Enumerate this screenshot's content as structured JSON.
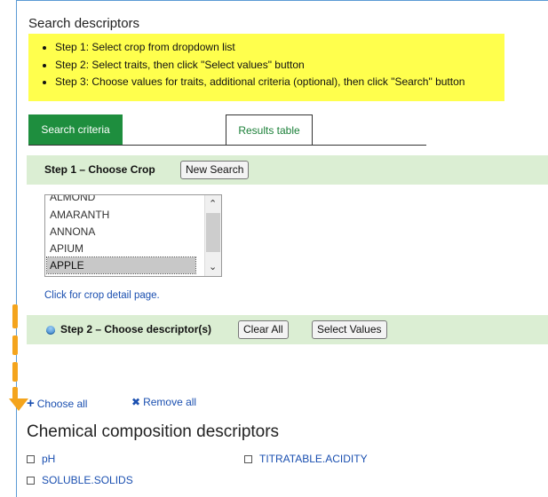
{
  "title": "Search descriptors",
  "instructions": [
    "Step 1: Select crop from dropdown list",
    "Step 2: Select traits, then click \"Select values\" button",
    "Step 3: Choose values for traits, additional criteria (optional), then click \"Search\" button"
  ],
  "tabs": {
    "search_criteria": "Search criteria",
    "results_table": "Results table"
  },
  "step1": {
    "label": "Step 1 – Choose Crop",
    "new_search": "New Search"
  },
  "crop_list": {
    "options": [
      "ALMOND",
      "AMARANTH",
      "ANNONA",
      "APIUM",
      "APPLE"
    ],
    "selected": "APPLE"
  },
  "crop_detail_link": "Click for crop detail page.",
  "step2": {
    "label": "Step 2 – Choose descriptor(s)",
    "clear_all": "Clear All",
    "select_values": "Select Values"
  },
  "choose_all": "Choose all",
  "remove_all": "Remove all",
  "section": {
    "title": "Chemical composition descriptors",
    "items": [
      "pH",
      "TITRATABLE.ACIDITY",
      "SOLUBLE.SOLIDS"
    ]
  },
  "colors": {
    "accent_green": "#1e8e3e",
    "step_bar": "#dbeed3",
    "highlight": "#ffff4d",
    "annotation": "#f4a41c",
    "link": "#1a4fb0"
  }
}
